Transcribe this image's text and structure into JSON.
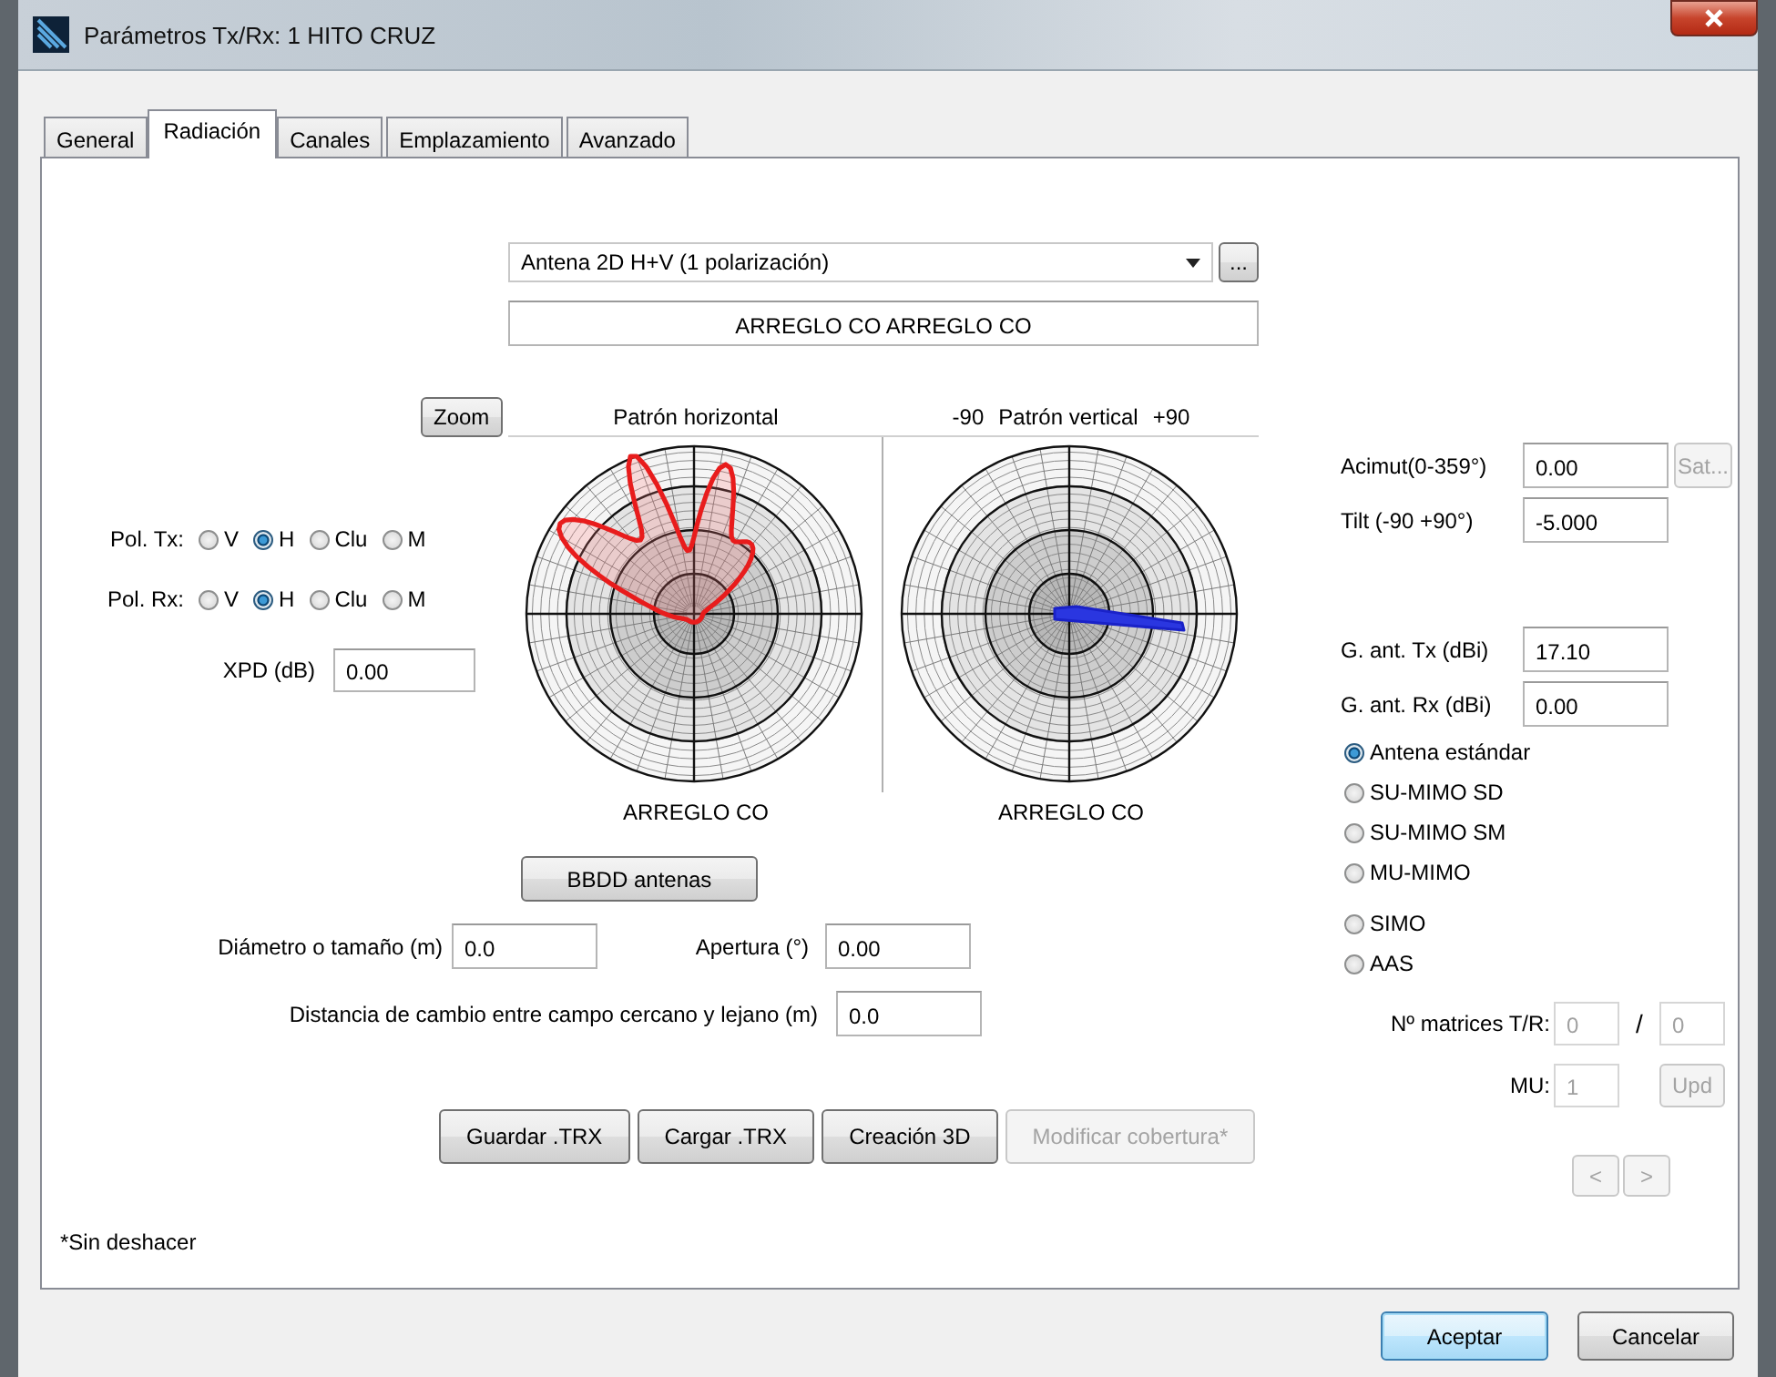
{
  "window": {
    "title": "Parámetros Tx/Rx: 1 HITO CRUZ"
  },
  "tabs": [
    {
      "label": "General",
      "selected": false
    },
    {
      "label": "Radiación",
      "selected": true
    },
    {
      "label": "Canales",
      "selected": false
    },
    {
      "label": "Emplazamiento",
      "selected": false
    },
    {
      "label": "Avanzado",
      "selected": false
    }
  ],
  "antenna": {
    "type": "Antena 2D H+V (1 polarización)",
    "browse_button": "...",
    "name": "ARREGLO CO ARREGLO CO"
  },
  "zoom_button": "Zoom",
  "polarization": [
    {
      "label": "Pol. Tx:",
      "options": [
        {
          "label": "V",
          "selected": false
        },
        {
          "label": "H",
          "selected": true
        },
        {
          "label": "Clu",
          "selected": false
        },
        {
          "label": "M",
          "selected": false
        }
      ]
    },
    {
      "label": "Pol. Rx:",
      "options": [
        {
          "label": "V",
          "selected": false
        },
        {
          "label": "H",
          "selected": true
        },
        {
          "label": "Clu",
          "selected": false
        },
        {
          "label": "M",
          "selected": false
        }
      ]
    }
  ],
  "xpd": {
    "label": "XPD (dB)",
    "value": "0.00"
  },
  "patterns": [
    {
      "kind": "horizontal",
      "title": "Patrón horizontal",
      "caption": "ARREGLO CO"
    },
    {
      "kind": "vertical",
      "min_label": "-90",
      "title": "Patrón vertical",
      "max_label": "+90",
      "caption": "ARREGLO CO"
    }
  ],
  "orientation": [
    {
      "label": "Acimut(0-359°)",
      "value": "0.00",
      "button": {
        "label": "Sat...",
        "disabled": true
      }
    },
    {
      "label": "Tilt (-90 +90°)",
      "value": "-5.000"
    }
  ],
  "gains": [
    {
      "label": "G. ant. Tx (dBi)",
      "value": "17.10"
    },
    {
      "label": "G. ant. Rx (dBi)",
      "value": "0.00"
    }
  ],
  "antenna_modes": [
    {
      "label": "Antena estándar",
      "selected": true
    },
    {
      "label": "SU-MIMO SD",
      "selected": false
    },
    {
      "label": "SU-MIMO SM",
      "selected": false
    },
    {
      "label": "MU-MIMO",
      "selected": false
    },
    {
      "label": "SIMO",
      "selected": false
    },
    {
      "label": "AAS",
      "selected": false
    }
  ],
  "matrices": {
    "label": "Nº matrices T/R:",
    "tx": "0",
    "separator": "/",
    "rx": "0",
    "disabled": true
  },
  "mu": {
    "label": "MU:",
    "value": "1",
    "disabled": true,
    "button": {
      "label": "Upd",
      "disabled": true
    }
  },
  "nav_buttons": [
    {
      "label": "<",
      "disabled": true
    },
    {
      "label": ">",
      "disabled": true
    }
  ],
  "bbdd_button": "BBDD antenas",
  "diameter": {
    "label": "Diámetro o tamaño (m)",
    "value": "0.0"
  },
  "aperture": {
    "label": "Apertura (°)",
    "value": "0.00"
  },
  "distance": {
    "label": "Distancia de cambio entre campo cercano y lejano (m)",
    "value": "0.0"
  },
  "actions": [
    {
      "label": "Guardar .TRX",
      "disabled": false
    },
    {
      "label": "Cargar .TRX",
      "disabled": false
    },
    {
      "label": "Creación 3D",
      "disabled": false
    },
    {
      "label": "Modificar cobertura*",
      "disabled": true
    }
  ],
  "note": "*Sin deshacer",
  "footer_buttons": [
    {
      "label": "Aceptar",
      "default": true
    },
    {
      "label": "Cancelar",
      "default": false
    }
  ]
}
